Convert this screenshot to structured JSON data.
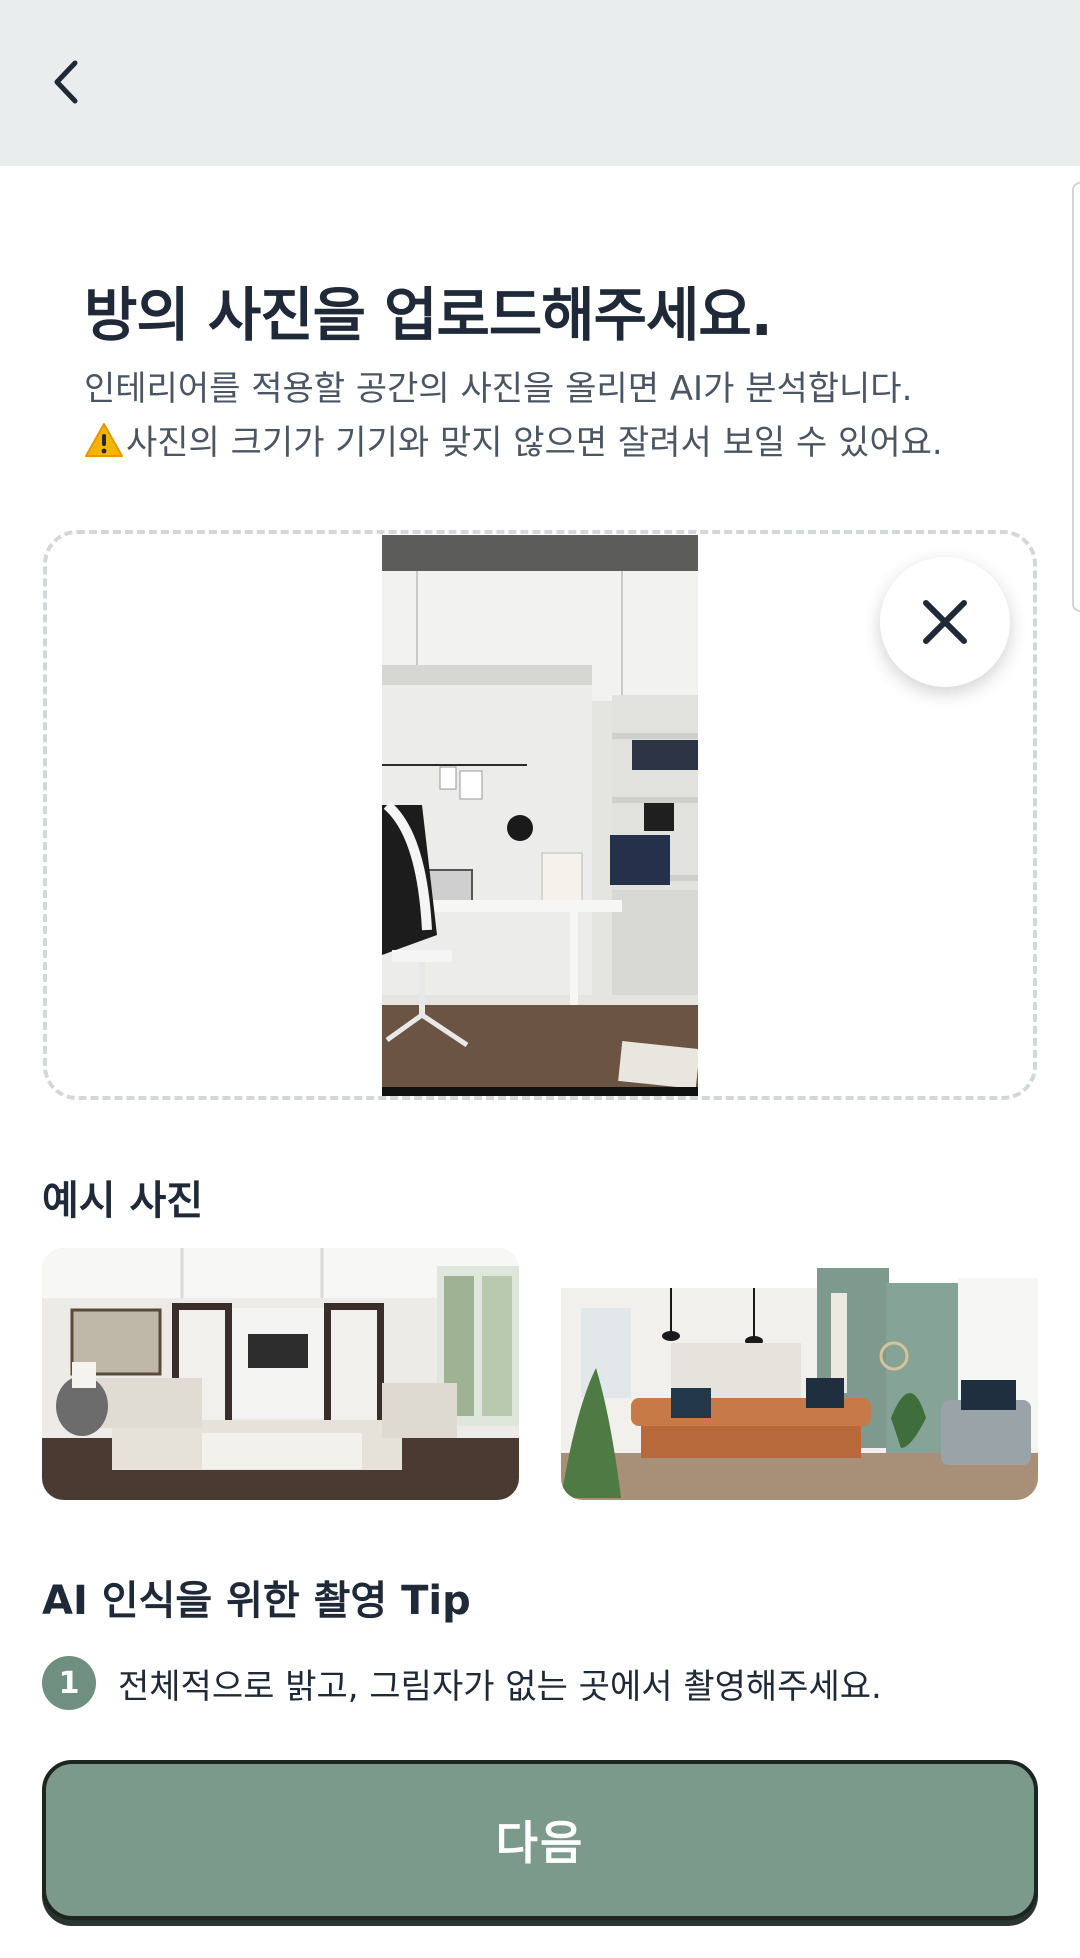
{
  "header": {
    "back_icon": "chevron-left-icon"
  },
  "main": {
    "title": "방의 사진을 업로드해주세요.",
    "description_line1": "인테리어를 적용할 공간의 사진을 올리면 AI가 분석합니다.",
    "description_line2": "사진의 크기가 기기와 맞지 않으면 잘려서 보일 수 있어요.",
    "warning_icon": "warning-icon"
  },
  "upload": {
    "remove_icon": "close-icon"
  },
  "examples": {
    "title": "예시 사진"
  },
  "tips": {
    "title": "AI 인식을 위한 촬영 Tip",
    "items": [
      {
        "number": "1",
        "text": "전체적으로 밝고, 그림자가 없는 곳에서 촬영해주세요."
      }
    ]
  },
  "footer": {
    "next_label": "다음"
  },
  "colors": {
    "header_bg": "#eaeded",
    "accent": "#7b9a8b",
    "text": "#1f2937"
  }
}
